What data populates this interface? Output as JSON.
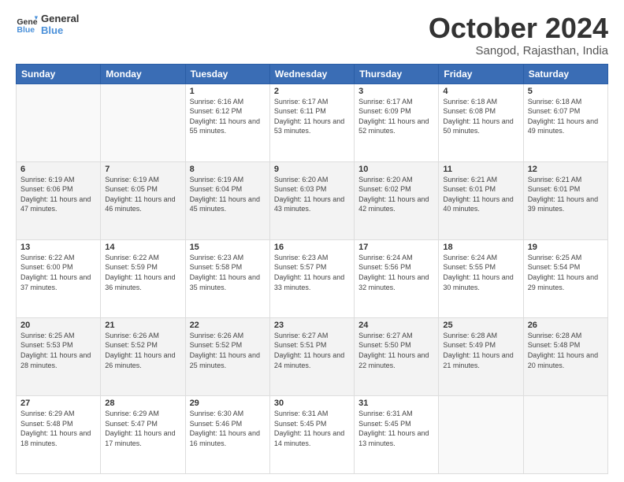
{
  "logo": {
    "line1": "General",
    "line2": "Blue"
  },
  "header": {
    "month": "October 2024",
    "location": "Sangod, Rajasthan, India"
  },
  "weekdays": [
    "Sunday",
    "Monday",
    "Tuesday",
    "Wednesday",
    "Thursday",
    "Friday",
    "Saturday"
  ],
  "weeks": [
    [
      {
        "day": "",
        "sunrise": "",
        "sunset": "",
        "daylight": ""
      },
      {
        "day": "",
        "sunrise": "",
        "sunset": "",
        "daylight": ""
      },
      {
        "day": "1",
        "sunrise": "Sunrise: 6:16 AM",
        "sunset": "Sunset: 6:12 PM",
        "daylight": "Daylight: 11 hours and 55 minutes."
      },
      {
        "day": "2",
        "sunrise": "Sunrise: 6:17 AM",
        "sunset": "Sunset: 6:11 PM",
        "daylight": "Daylight: 11 hours and 53 minutes."
      },
      {
        "day": "3",
        "sunrise": "Sunrise: 6:17 AM",
        "sunset": "Sunset: 6:09 PM",
        "daylight": "Daylight: 11 hours and 52 minutes."
      },
      {
        "day": "4",
        "sunrise": "Sunrise: 6:18 AM",
        "sunset": "Sunset: 6:08 PM",
        "daylight": "Daylight: 11 hours and 50 minutes."
      },
      {
        "day": "5",
        "sunrise": "Sunrise: 6:18 AM",
        "sunset": "Sunset: 6:07 PM",
        "daylight": "Daylight: 11 hours and 49 minutes."
      }
    ],
    [
      {
        "day": "6",
        "sunrise": "Sunrise: 6:19 AM",
        "sunset": "Sunset: 6:06 PM",
        "daylight": "Daylight: 11 hours and 47 minutes."
      },
      {
        "day": "7",
        "sunrise": "Sunrise: 6:19 AM",
        "sunset": "Sunset: 6:05 PM",
        "daylight": "Daylight: 11 hours and 46 minutes."
      },
      {
        "day": "8",
        "sunrise": "Sunrise: 6:19 AM",
        "sunset": "Sunset: 6:04 PM",
        "daylight": "Daylight: 11 hours and 45 minutes."
      },
      {
        "day": "9",
        "sunrise": "Sunrise: 6:20 AM",
        "sunset": "Sunset: 6:03 PM",
        "daylight": "Daylight: 11 hours and 43 minutes."
      },
      {
        "day": "10",
        "sunrise": "Sunrise: 6:20 AM",
        "sunset": "Sunset: 6:02 PM",
        "daylight": "Daylight: 11 hours and 42 minutes."
      },
      {
        "day": "11",
        "sunrise": "Sunrise: 6:21 AM",
        "sunset": "Sunset: 6:01 PM",
        "daylight": "Daylight: 11 hours and 40 minutes."
      },
      {
        "day": "12",
        "sunrise": "Sunrise: 6:21 AM",
        "sunset": "Sunset: 6:01 PM",
        "daylight": "Daylight: 11 hours and 39 minutes."
      }
    ],
    [
      {
        "day": "13",
        "sunrise": "Sunrise: 6:22 AM",
        "sunset": "Sunset: 6:00 PM",
        "daylight": "Daylight: 11 hours and 37 minutes."
      },
      {
        "day": "14",
        "sunrise": "Sunrise: 6:22 AM",
        "sunset": "Sunset: 5:59 PM",
        "daylight": "Daylight: 11 hours and 36 minutes."
      },
      {
        "day": "15",
        "sunrise": "Sunrise: 6:23 AM",
        "sunset": "Sunset: 5:58 PM",
        "daylight": "Daylight: 11 hours and 35 minutes."
      },
      {
        "day": "16",
        "sunrise": "Sunrise: 6:23 AM",
        "sunset": "Sunset: 5:57 PM",
        "daylight": "Daylight: 11 hours and 33 minutes."
      },
      {
        "day": "17",
        "sunrise": "Sunrise: 6:24 AM",
        "sunset": "Sunset: 5:56 PM",
        "daylight": "Daylight: 11 hours and 32 minutes."
      },
      {
        "day": "18",
        "sunrise": "Sunrise: 6:24 AM",
        "sunset": "Sunset: 5:55 PM",
        "daylight": "Daylight: 11 hours and 30 minutes."
      },
      {
        "day": "19",
        "sunrise": "Sunrise: 6:25 AM",
        "sunset": "Sunset: 5:54 PM",
        "daylight": "Daylight: 11 hours and 29 minutes."
      }
    ],
    [
      {
        "day": "20",
        "sunrise": "Sunrise: 6:25 AM",
        "sunset": "Sunset: 5:53 PM",
        "daylight": "Daylight: 11 hours and 28 minutes."
      },
      {
        "day": "21",
        "sunrise": "Sunrise: 6:26 AM",
        "sunset": "Sunset: 5:52 PM",
        "daylight": "Daylight: 11 hours and 26 minutes."
      },
      {
        "day": "22",
        "sunrise": "Sunrise: 6:26 AM",
        "sunset": "Sunset: 5:52 PM",
        "daylight": "Daylight: 11 hours and 25 minutes."
      },
      {
        "day": "23",
        "sunrise": "Sunrise: 6:27 AM",
        "sunset": "Sunset: 5:51 PM",
        "daylight": "Daylight: 11 hours and 24 minutes."
      },
      {
        "day": "24",
        "sunrise": "Sunrise: 6:27 AM",
        "sunset": "Sunset: 5:50 PM",
        "daylight": "Daylight: 11 hours and 22 minutes."
      },
      {
        "day": "25",
        "sunrise": "Sunrise: 6:28 AM",
        "sunset": "Sunset: 5:49 PM",
        "daylight": "Daylight: 11 hours and 21 minutes."
      },
      {
        "day": "26",
        "sunrise": "Sunrise: 6:28 AM",
        "sunset": "Sunset: 5:48 PM",
        "daylight": "Daylight: 11 hours and 20 minutes."
      }
    ],
    [
      {
        "day": "27",
        "sunrise": "Sunrise: 6:29 AM",
        "sunset": "Sunset: 5:48 PM",
        "daylight": "Daylight: 11 hours and 18 minutes."
      },
      {
        "day": "28",
        "sunrise": "Sunrise: 6:29 AM",
        "sunset": "Sunset: 5:47 PM",
        "daylight": "Daylight: 11 hours and 17 minutes."
      },
      {
        "day": "29",
        "sunrise": "Sunrise: 6:30 AM",
        "sunset": "Sunset: 5:46 PM",
        "daylight": "Daylight: 11 hours and 16 minutes."
      },
      {
        "day": "30",
        "sunrise": "Sunrise: 6:31 AM",
        "sunset": "Sunset: 5:45 PM",
        "daylight": "Daylight: 11 hours and 14 minutes."
      },
      {
        "day": "31",
        "sunrise": "Sunrise: 6:31 AM",
        "sunset": "Sunset: 5:45 PM",
        "daylight": "Daylight: 11 hours and 13 minutes."
      },
      {
        "day": "",
        "sunrise": "",
        "sunset": "",
        "daylight": ""
      },
      {
        "day": "",
        "sunrise": "",
        "sunset": "",
        "daylight": ""
      }
    ]
  ]
}
